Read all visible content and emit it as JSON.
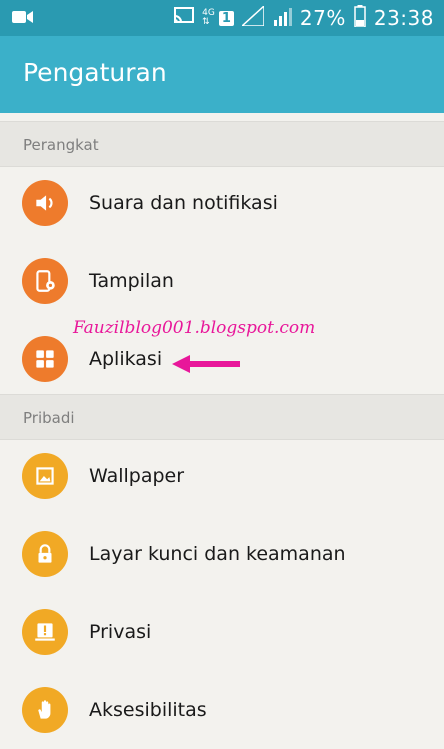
{
  "status_bar": {
    "network_type": "4G",
    "sim_badge": "1",
    "battery_percent": "27%",
    "time": "23:38",
    "icons": [
      "video-icon",
      "cast-icon",
      "signal-1-icon",
      "signal-2-icon",
      "battery-icon"
    ]
  },
  "header": {
    "title": "Pengaturan"
  },
  "sections": [
    {
      "title": "Perangkat",
      "items": [
        {
          "label": "Suara dan notifikasi",
          "icon": "speaker-icon",
          "color": "#ee7b2c"
        },
        {
          "label": "Tampilan",
          "icon": "display-settings-icon",
          "color": "#ee7b2c"
        },
        {
          "label": "Aplikasi",
          "icon": "apps-grid-icon",
          "color": "#ee7b2c"
        }
      ]
    },
    {
      "title": "Pribadi",
      "items": [
        {
          "label": "Wallpaper",
          "icon": "image-icon",
          "color": "#f1a925"
        },
        {
          "label": "Layar kunci dan keamanan",
          "icon": "lock-icon",
          "color": "#f1a925"
        },
        {
          "label": "Privasi",
          "icon": "privacy-icon",
          "color": "#f1a925"
        },
        {
          "label": "Aksesibilitas",
          "icon": "hand-icon",
          "color": "#f1a925"
        }
      ]
    }
  ],
  "annotation": {
    "watermark": "Fauzilblog001.blogspot.com",
    "arrow_color": "#e8179a"
  },
  "colors": {
    "status_bar": "#2a9ab1",
    "app_bar": "#3bb0c9",
    "background": "#f3f2ee"
  }
}
